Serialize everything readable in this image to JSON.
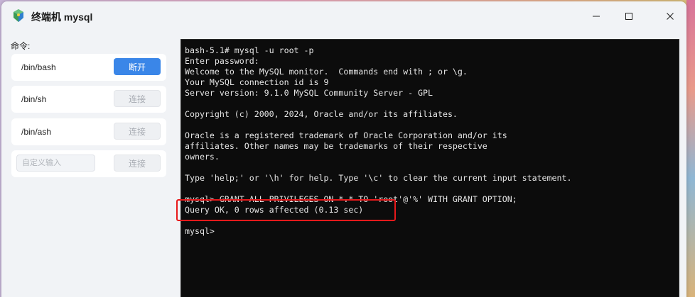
{
  "window": {
    "title": "终端机 mysql",
    "controls": {
      "minimize": "—",
      "maximize": "☐",
      "close": "✕"
    }
  },
  "sidebar": {
    "label": "命令:",
    "commands": [
      {
        "name": "/bin/bash",
        "button": "断开",
        "active": true
      },
      {
        "name": "/bin/sh",
        "button": "连接",
        "active": false
      },
      {
        "name": "/bin/ash",
        "button": "连接",
        "active": false
      }
    ],
    "custom": {
      "placeholder": "自定义输入",
      "button": "连接"
    }
  },
  "terminal": {
    "lines": [
      "bash-5.1# mysql -u root -p",
      "Enter password:",
      "Welcome to the MySQL monitor.  Commands end with ; or \\g.",
      "Your MySQL connection id is 9",
      "Server version: 9.1.0 MySQL Community Server - GPL",
      "",
      "Copyright (c) 2000, 2024, Oracle and/or its affiliates.",
      "",
      "Oracle is a registered trademark of Oracle Corporation and/or its",
      "affiliates. Other names may be trademarks of their respective",
      "owners.",
      "",
      "Type 'help;' or '\\h' for help. Type '\\c' to clear the current input statement.",
      "",
      "mysql> GRANT ALL PRIVILEGES ON *.* TO 'root'@'%' WITH GRANT OPTION;",
      "Query OK, 0 rows affected (0.13 sec)",
      "",
      "mysql>"
    ]
  },
  "colors": {
    "primary_button": "#3a86e8",
    "terminal_bg": "#0c0c0c",
    "highlight": "#e8191b"
  }
}
